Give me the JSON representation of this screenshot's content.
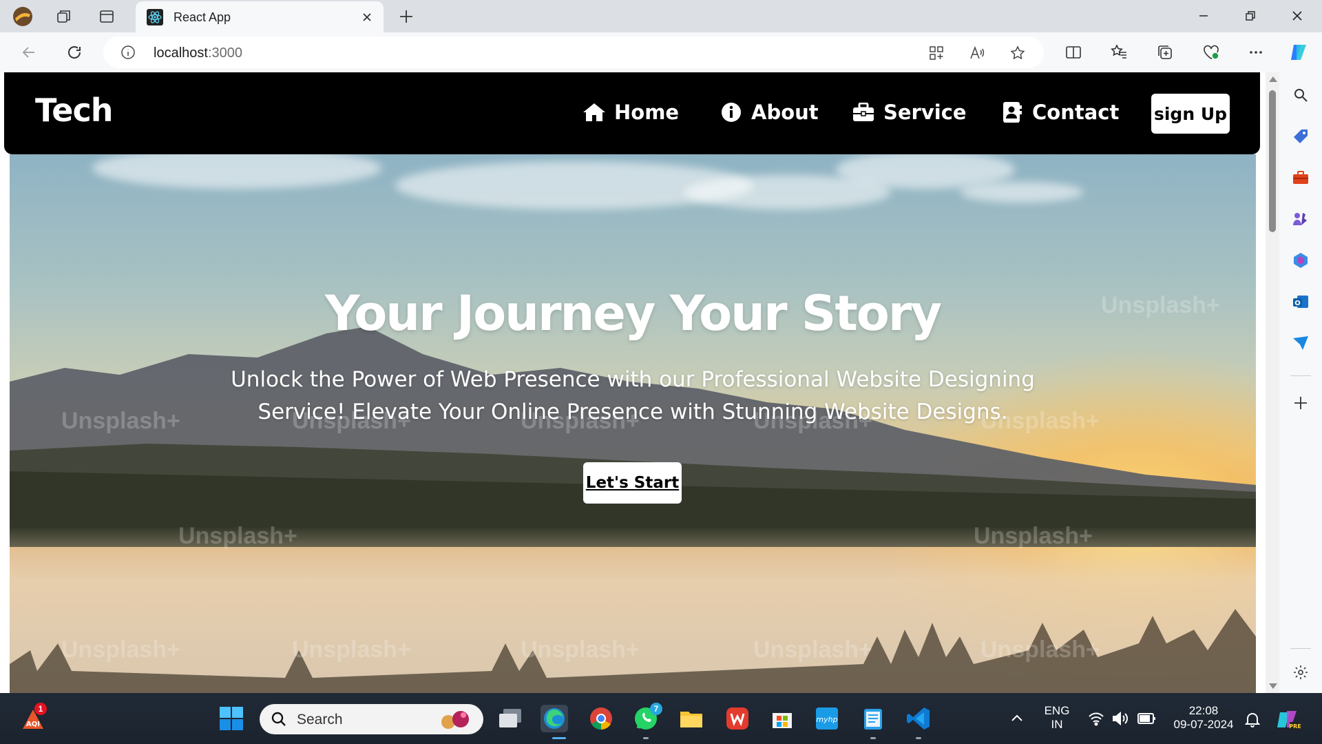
{
  "browser": {
    "tab_title": "React App",
    "url_host": "localhost",
    "url_port": ":3000"
  },
  "site": {
    "brand": "Tech",
    "nav": [
      {
        "label": "Home",
        "icon": "home-icon"
      },
      {
        "label": "About",
        "icon": "info-icon"
      },
      {
        "label": "Service",
        "icon": "briefcase-icon"
      },
      {
        "label": "Contact",
        "icon": "contact-card-icon"
      }
    ],
    "signup_label": "sign Up",
    "hero": {
      "title": "Your Journey Your Story",
      "subtitle": "Unlock the Power of Web Presence with our Professional Website Designing Service! Elevate Your Online Presence with Stunning Website Designs.",
      "cta_label": "Let's Start",
      "watermark": "Unsplash+"
    }
  },
  "taskbar": {
    "search_label": "Search",
    "whatsapp_badge": "7",
    "widget_badge": "1",
    "language_line1": "ENG",
    "language_line2": "IN",
    "time": "22:08",
    "date": "09-07-2024"
  },
  "colors": {
    "nav_bg": "#000000",
    "page_text": "#ffffff",
    "chrome_bg": "#f7f8fa"
  }
}
